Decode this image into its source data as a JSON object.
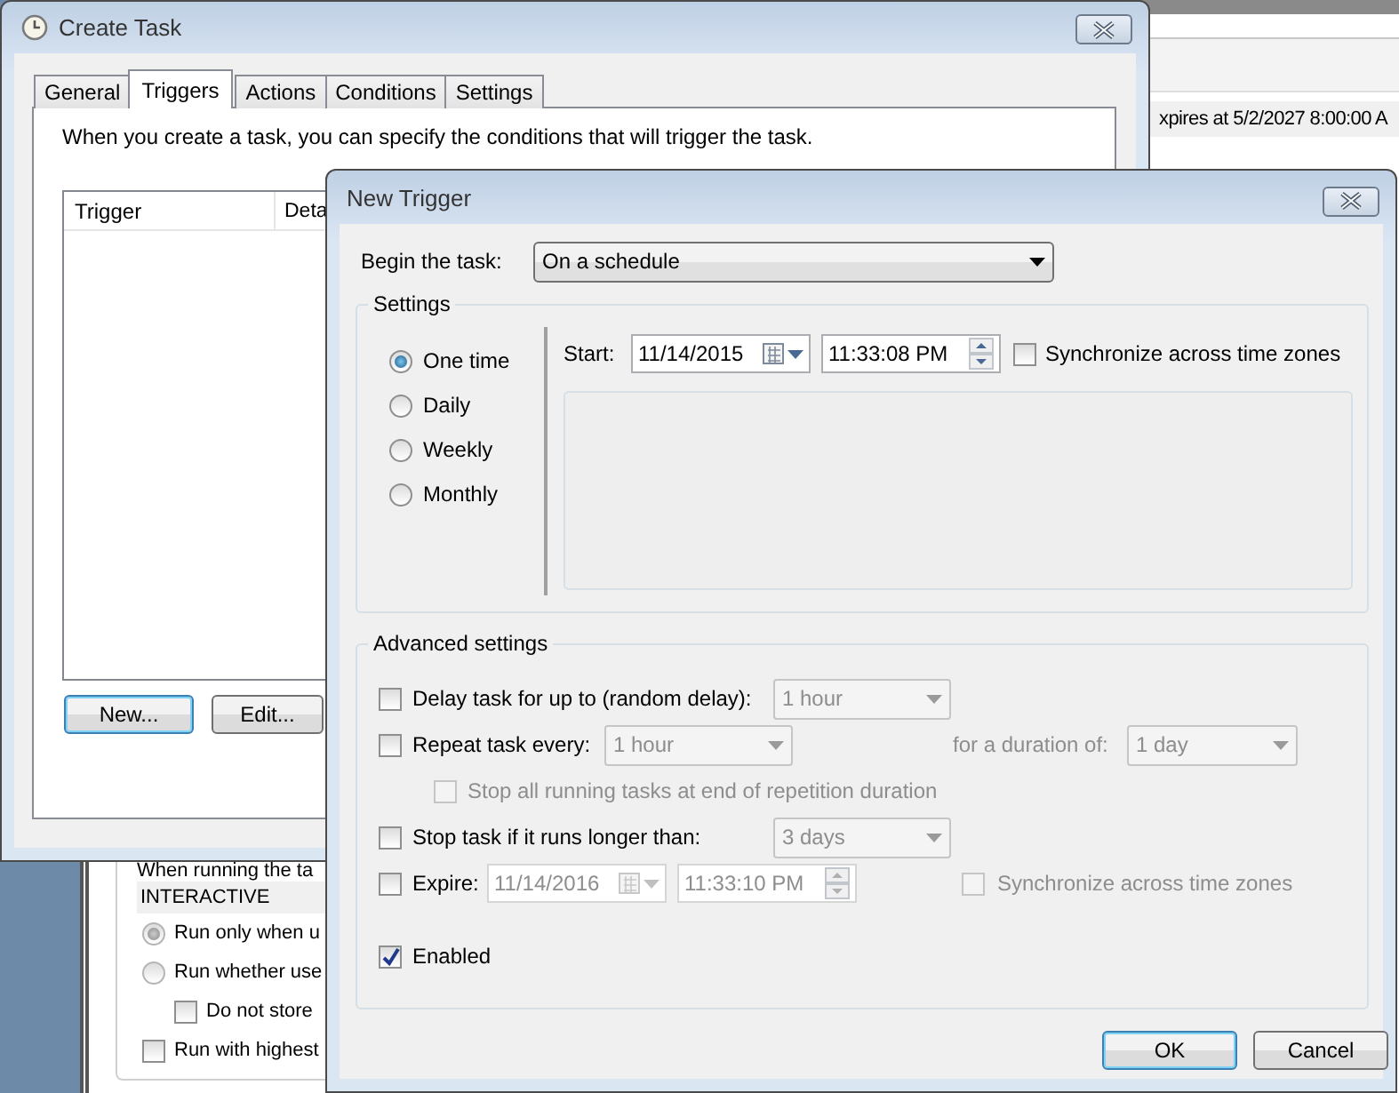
{
  "background_window": {
    "status_text": "xpires at 5/2/2027 8:00:00 A",
    "security_note": "When running the ta",
    "user_account": "INTERACTIVE",
    "run_options": [
      {
        "label": "Run only when u",
        "selected": true
      },
      {
        "label": "Run whether use",
        "selected": false
      }
    ],
    "do_not_store": {
      "label": "Do not store",
      "checked": false
    },
    "run_highest": {
      "label": "Run with highest",
      "checked": false
    }
  },
  "create_task": {
    "title": "Create Task",
    "tabs": [
      {
        "label": "General",
        "selected": false
      },
      {
        "label": "Triggers",
        "selected": true
      },
      {
        "label": "Actions",
        "selected": false
      },
      {
        "label": "Conditions",
        "selected": false
      },
      {
        "label": "Settings",
        "selected": false
      }
    ],
    "description": "When you create a task, you can specify the conditions that will trigger the task.",
    "table": {
      "columns": [
        "Trigger",
        "Deta"
      ]
    },
    "buttons": [
      {
        "label": "New...",
        "default": true
      },
      {
        "label": "Edit...",
        "default": false
      }
    ]
  },
  "new_trigger": {
    "title": "New Trigger",
    "begin_label": "Begin the task:",
    "begin_value": "On a schedule",
    "settings_title": "Settings",
    "schedules": [
      {
        "label": "One time",
        "selected": true
      },
      {
        "label": "Daily",
        "selected": false
      },
      {
        "label": "Weekly",
        "selected": false
      },
      {
        "label": "Monthly",
        "selected": false
      }
    ],
    "start_label": "Start:",
    "start_date": "11/14/2015",
    "start_time": "11:33:08 PM",
    "sync": {
      "label": "Synchronize across time zones",
      "checked": false
    },
    "advanced_title": "Advanced settings",
    "delay": {
      "label": "Delay task for up to (random delay):",
      "checked": false,
      "value": "1 hour",
      "disabled": true
    },
    "repeat": {
      "label": "Repeat task every:",
      "checked": false,
      "value": "1 hour",
      "disabled": true,
      "duration_label": "for a duration of:",
      "duration_value": "1 day"
    },
    "stop_all": {
      "label": "Stop all running tasks at end of repetition duration",
      "checked": false,
      "disabled": true
    },
    "stop_task": {
      "label": "Stop task if it runs longer than:",
      "checked": false,
      "value": "3 days",
      "disabled": true
    },
    "expire": {
      "label": "Expire:",
      "checked": false,
      "date": "11/14/2016",
      "time": "11:33:10 PM",
      "disabled": true,
      "sync_label": "Synchronize across time zones",
      "sync_checked": false
    },
    "enabled": {
      "label": "Enabled",
      "checked": true
    },
    "buttons": [
      {
        "label": "OK",
        "default": true
      },
      {
        "label": "Cancel",
        "default": false
      }
    ]
  }
}
